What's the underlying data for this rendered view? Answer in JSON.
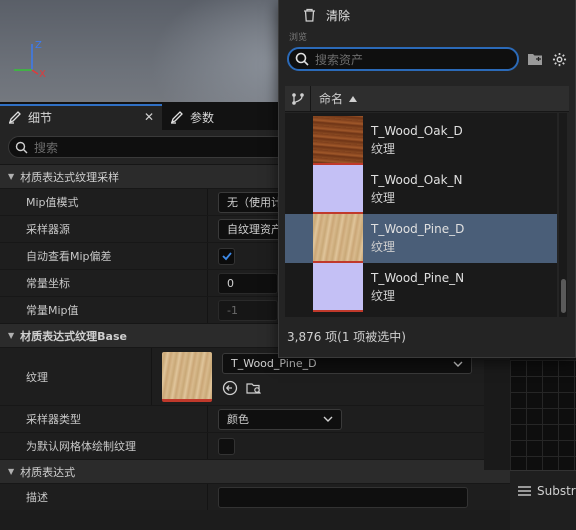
{
  "picker": {
    "clear_label": "清除",
    "browse_label": "浏览",
    "search_placeholder": "搜索资产",
    "column_name": "命名",
    "items": [
      {
        "name": "T_Wood_Oak_D",
        "type": "纹理",
        "selected": false
      },
      {
        "name": "T_Wood_Oak_N",
        "type": "纹理",
        "selected": false
      },
      {
        "name": "T_Wood_Pine_D",
        "type": "纹理",
        "selected": true
      },
      {
        "name": "T_Wood_Pine_N",
        "type": "纹理",
        "selected": false
      }
    ],
    "footer": "3,876 项(1 项被选中)"
  },
  "details": {
    "tab_details": "细节",
    "tab_params": "参数",
    "search_placeholder": "搜索",
    "section1": "材质表达式纹理采样",
    "mip_mode_label": "Mip值模式",
    "mip_mode_value": "无（使用计",
    "sampler_source_label": "采样器源",
    "sampler_source_value": "自纹理资产",
    "auto_mip_label": "自动查看Mip偏差",
    "const_coord_label": "常量坐标",
    "const_coord_value": "0",
    "const_mip_label": "常量Mip值",
    "const_mip_value": "-1",
    "section2": "材质表达式纹理Base",
    "texture_label": "纹理",
    "texture_value": "T_Wood_Pine_D",
    "sampler_type_label": "采样器类型",
    "sampler_type_value": "颜色",
    "default_mesh_label": "为默认网格体绘制纹理",
    "section3": "材质表达式",
    "desc_label": "描述"
  },
  "right": {
    "substrate_label": "Substr"
  },
  "gizmo": {
    "z": "Z",
    "x": "X"
  }
}
